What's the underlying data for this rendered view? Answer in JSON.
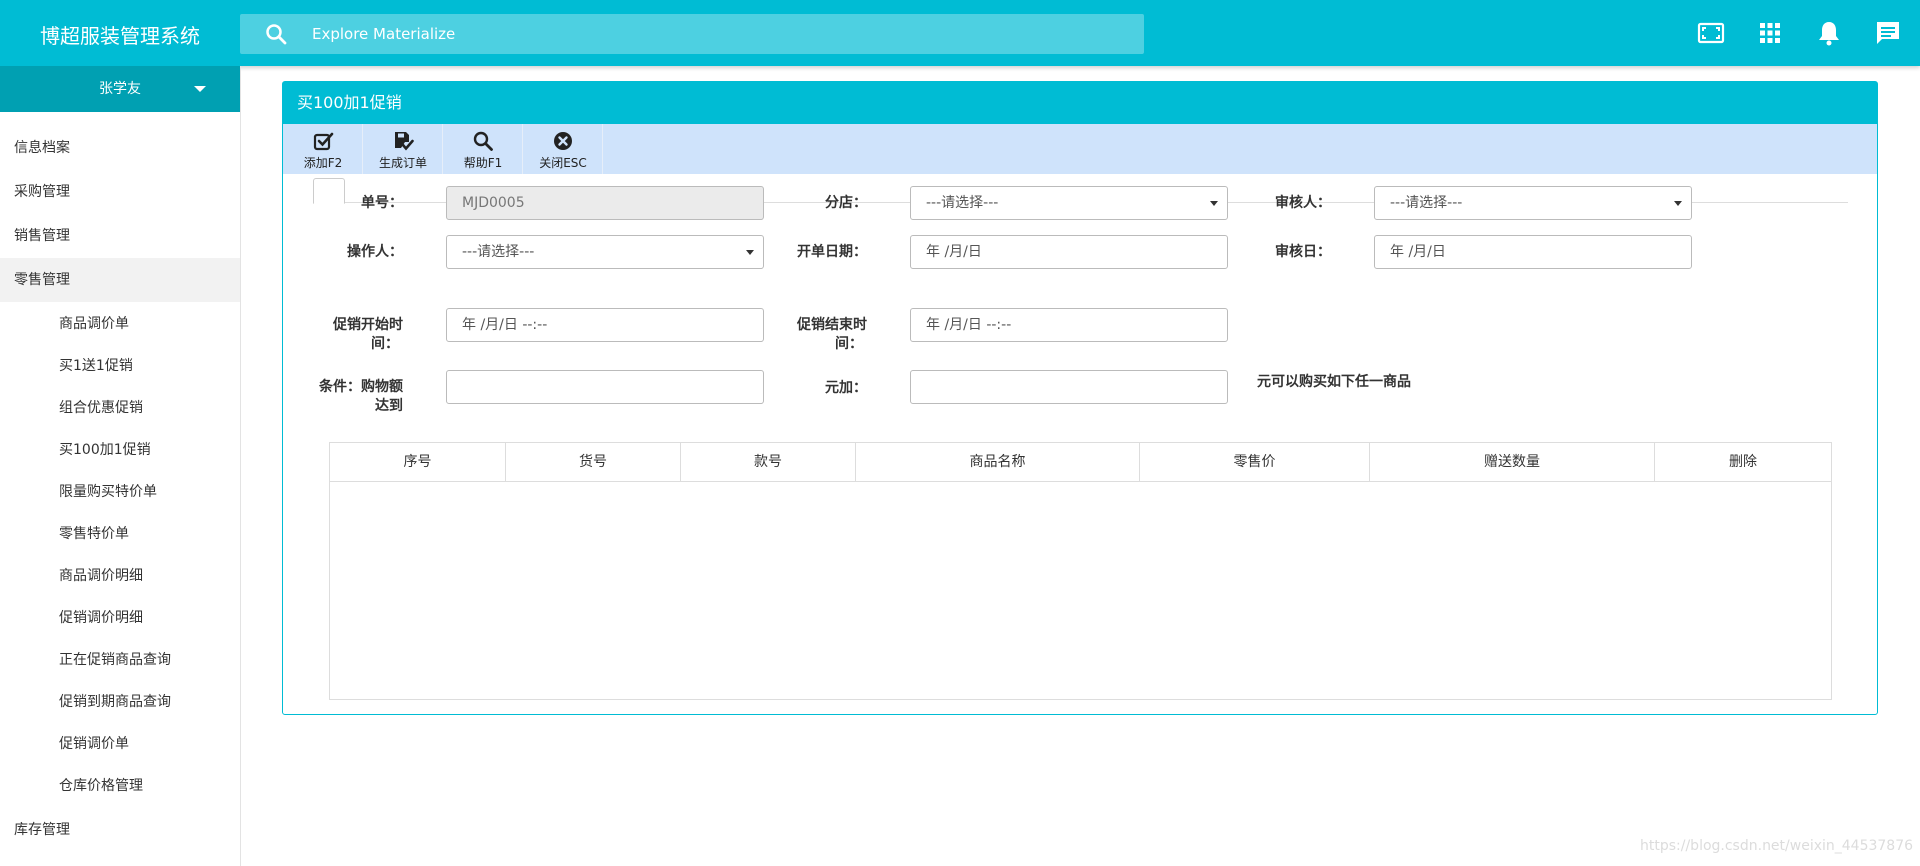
{
  "app": {
    "title": "博超服装管理系统"
  },
  "search": {
    "placeholder": "Explore Materialize"
  },
  "topbar_icons": [
    "fullscreen-icon",
    "apps-grid-icon",
    "notifications-bell-icon",
    "chat-message-icon"
  ],
  "sidebar": {
    "user": "张学友",
    "items": [
      {
        "label": "信息档案"
      },
      {
        "label": "采购管理"
      },
      {
        "label": "销售管理"
      },
      {
        "label": "零售管理",
        "active": true,
        "children": [
          "商品调价单",
          "买1送1促销",
          "组合优惠促销",
          "买100加1促销",
          "限量购买特价单",
          "零售特价单",
          "商品调价明细",
          "促销调价明细",
          "正在促销商品查询",
          "促销到期商品查询",
          "促销调价单",
          "仓库价格管理"
        ]
      },
      {
        "label": "库存管理"
      }
    ]
  },
  "panel": {
    "title": "买100加1促销",
    "toolbar": [
      {
        "label": "添加F2",
        "icon": "check-square-icon"
      },
      {
        "label": "生成订单",
        "icon": "save-doc-icon"
      },
      {
        "label": "帮助F1",
        "icon": "magnifier-icon"
      },
      {
        "label": "关闭ESC",
        "icon": "close-circle-icon"
      }
    ]
  },
  "form": {
    "order_no": {
      "label": "单号：",
      "value": "MJD0005"
    },
    "branch": {
      "label": "分店：",
      "value": "---请选择---"
    },
    "auditor": {
      "label": "审核人：",
      "value": "---请选择---"
    },
    "operator": {
      "label": "操作人：",
      "value": "---请选择---"
    },
    "open_date": {
      "label": "开单日期：",
      "value": "年 /月/日"
    },
    "audit_date": {
      "label": "审核日：",
      "value": "年 /月/日"
    },
    "promo_start": {
      "label_line1": "促销开始时",
      "label_line2": "间：",
      "value": "年 /月/日 --:--"
    },
    "promo_end": {
      "label_line1": "促销结束时",
      "label_line2": "间：",
      "value": "年 /月/日 --:--"
    },
    "condition": {
      "label_line1": "条件：购物额",
      "label_line2": "达到",
      "value": ""
    },
    "plus": {
      "label": "元加：",
      "value": ""
    },
    "note": "元可以购买如下任一商品"
  },
  "table": {
    "columns": [
      "序号",
      "货号",
      "款号",
      "商品名称",
      "零售价",
      "赠送数量",
      "删除"
    ],
    "rows": []
  },
  "watermark": "https://blog.csdn.net/weixin_44537876"
}
